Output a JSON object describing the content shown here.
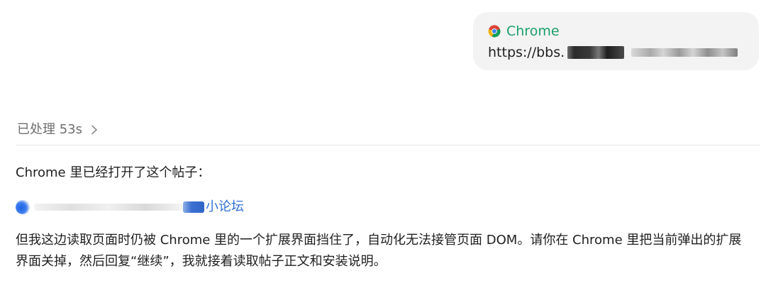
{
  "user_message": {
    "source_icon": "chrome-icon",
    "source_label": "Chrome",
    "url_text": "https://bbs.",
    "colors": {
      "source_label": "#1a9f6c",
      "bubble_bg": "#f3f3f3"
    }
  },
  "processing": {
    "label": "已处理 53s",
    "chevron_icon": "chevron-right-icon"
  },
  "assistant_message": {
    "intro": "Chrome 里已经打开了这个帖子：",
    "post_link_label": "小论坛",
    "body": "但我这边读取页面时仍被 Chrome 里的一个扩展界面挡住了，自动化无法接管页面 DOM。请你在 Chrome 里把当前弹出的扩展界面关掉，然后回复“继续”，我就接着读取帖子正文和安装说明。",
    "colors": {
      "link": "#2f6fd6"
    }
  }
}
